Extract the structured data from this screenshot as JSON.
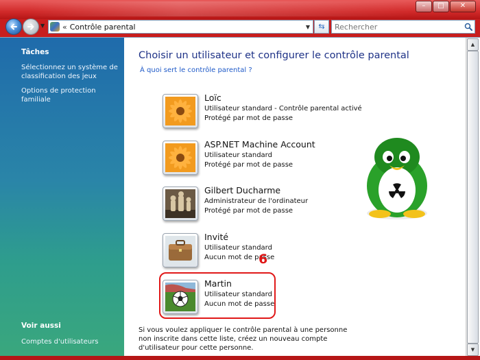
{
  "window": {
    "minimize_label": "–",
    "maximize_label": "□",
    "close_label": "✕"
  },
  "navbar": {
    "address_separator": "«",
    "address_text": "Contrôle parental",
    "search_placeholder": "Rechercher"
  },
  "sidebar": {
    "tasks_heading": "Tâches",
    "task_links": [
      "Sélectionnez un système de classification des jeux",
      "Options de protection familiale"
    ],
    "see_also_heading": "Voir aussi",
    "see_also_links": [
      "Comptes d'utilisateurs"
    ]
  },
  "main": {
    "title": "Choisir un utilisateur et configurer le contrôle parental",
    "help_link": "À quoi sert le contrôle parental ?",
    "users": [
      {
        "name": "Loïc",
        "line1": "Utilisateur standard - Contrôle parental activé",
        "line2": "Protégé par mot de passe",
        "icon": "flower-icon"
      },
      {
        "name": "ASP.NET Machine Account",
        "line1": "Utilisateur standard",
        "line2": "Protégé par mot de passe",
        "icon": "flower-icon"
      },
      {
        "name": "Gilbert Ducharme",
        "line1": "Administrateur de l'ordinateur",
        "line2": "Protégé par mot de passe",
        "icon": "chess-icon"
      },
      {
        "name": "Invité",
        "line1": "Utilisateur standard",
        "line2": "Aucun mot de passe",
        "icon": "briefcase-icon"
      },
      {
        "name": "Martin",
        "line1": "Utilisateur standard",
        "line2": "Aucun mot de passe",
        "icon": "soccer-ball-icon"
      }
    ],
    "annotation_number": "6",
    "footer_text": "Si vous voulez appliquer le contrôle parental à une personne non inscrite dans cette liste, créez un nouveau compte d'utilisateur pour cette personne."
  },
  "colors": {
    "desktop_red": "#c81e1e",
    "title_blue": "#1e3287",
    "link_blue": "#1f5ac8",
    "highlight_red": "#e01818",
    "penguin_green": "#2aa12a"
  }
}
